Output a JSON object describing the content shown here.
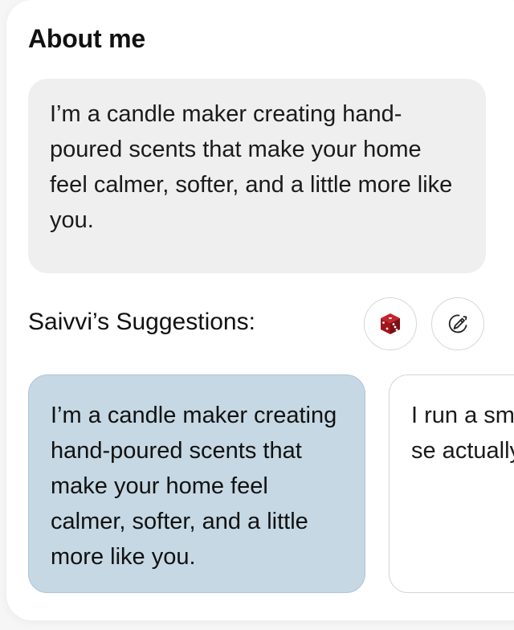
{
  "about": {
    "title": "About me",
    "bio_text": "I’m a candle maker creating hand-poured scents that make your home feel calmer, softer, and a little more like you."
  },
  "suggestions": {
    "label": "Saivvi’s Suggestions:",
    "dice_icon": "dice-icon",
    "edit_icon": "pen-rotate-icon",
    "items": [
      {
        "text": "I’m a candle maker creating hand-poured scents that make your home feel calmer, softer, and a little more like you.",
        "selected": true
      },
      {
        "text": "I run a sm studio m mood-se actually f (without t",
        "selected": false
      }
    ]
  },
  "colors": {
    "selected_bg": "#c5d8e4",
    "bio_bg": "#efeff0",
    "dice_red": "#a0151b"
  }
}
